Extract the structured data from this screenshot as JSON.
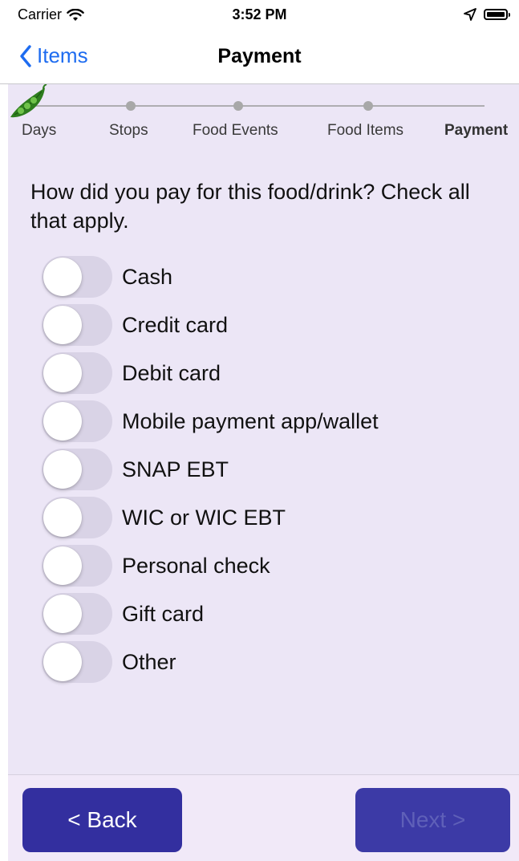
{
  "status_bar": {
    "carrier": "Carrier",
    "time": "3:52 PM",
    "icons": [
      "wifi-icon",
      "location-arrow-icon",
      "battery-icon"
    ]
  },
  "nav": {
    "back_label": "Items",
    "title": "Payment"
  },
  "progress": {
    "steps": [
      {
        "label": "Days",
        "active": false
      },
      {
        "label": "Stops",
        "active": false
      },
      {
        "label": "Food Events",
        "active": false
      },
      {
        "label": "Food Items",
        "active": false
      },
      {
        "label": "Payment",
        "active": true
      }
    ],
    "current_icon": "pea-pod-icon"
  },
  "question": "How did you pay for this food/drink? Check all that apply.",
  "options": [
    {
      "label": "Cash",
      "checked": false
    },
    {
      "label": "Credit card",
      "checked": false
    },
    {
      "label": "Debit card",
      "checked": false
    },
    {
      "label": "Mobile payment app/wallet",
      "checked": false
    },
    {
      "label": "SNAP EBT",
      "checked": false
    },
    {
      "label": "WIC or WIC EBT",
      "checked": false
    },
    {
      "label": "Personal check",
      "checked": false
    },
    {
      "label": "Gift card",
      "checked": false
    },
    {
      "label": "Other",
      "checked": false
    }
  ],
  "buttons": {
    "back": "< Back",
    "next": "Next >",
    "next_enabled": false
  },
  "colors": {
    "accent": "#1e6cf0",
    "panel": "#ece6f6",
    "button": "#332f9f",
    "toggle_off": "#d9d3e6"
  }
}
